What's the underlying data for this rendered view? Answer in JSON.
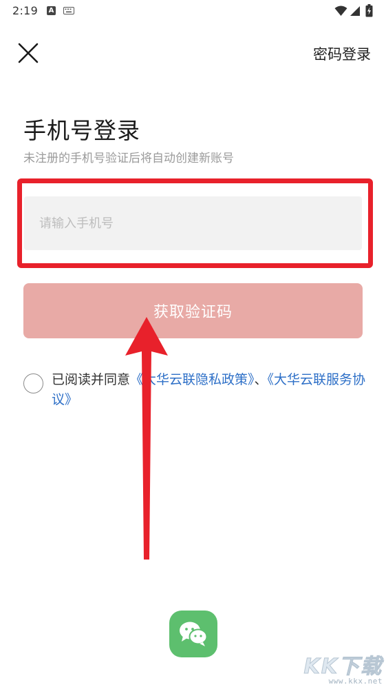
{
  "status_bar": {
    "time": "2:19",
    "notification_icon": "A"
  },
  "header": {
    "close_icon": "close-icon",
    "password_login_label": "密码登录"
  },
  "main": {
    "title": "手机号登录",
    "subtitle": "未注册的手机号验证后将自动创建新账号",
    "phone_input": {
      "value": "",
      "placeholder": "请输入手机号"
    },
    "get_code_label": "获取验证码"
  },
  "agreement": {
    "checked": false,
    "prefix": "已阅读并同意",
    "privacy_policy": "《大华云联隐私政策》",
    "separator": "、",
    "service_agreement": "《大华云联服务协议》"
  },
  "footer": {
    "wechat_icon": "wechat-icon"
  },
  "watermark": {
    "logo_text": "KK下载",
    "url": "www.kkx.net"
  },
  "colors": {
    "highlight_border": "#e8212b",
    "button_disabled": "#e8aaa6",
    "link": "#2d6fc7",
    "wechat_green": "#5dbf6e",
    "arrow_red": "#e8212b"
  }
}
